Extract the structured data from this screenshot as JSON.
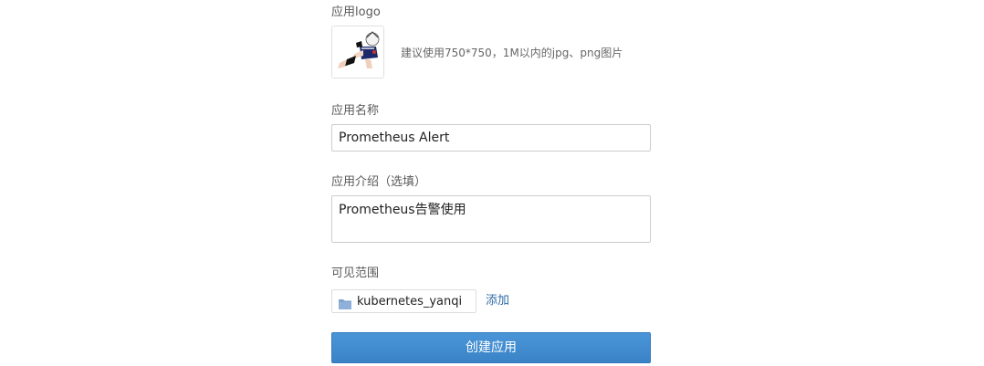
{
  "logo": {
    "label": "应用logo",
    "hint": "建议使用750*750，1M以内的jpg、png图片"
  },
  "app_name": {
    "label": "应用名称",
    "value": "Prometheus Alert"
  },
  "app_description": {
    "label": "应用介绍（选填）",
    "value": "Prometheus告警使用"
  },
  "visibility": {
    "label": "可见范围",
    "selected": "kubernetes_yanqi",
    "add_label": "添加",
    "folder_icon": "folder-icon",
    "folder_color": "#7fa3cf"
  },
  "submit": {
    "label": "创建应用",
    "color": "#3a83c7"
  }
}
